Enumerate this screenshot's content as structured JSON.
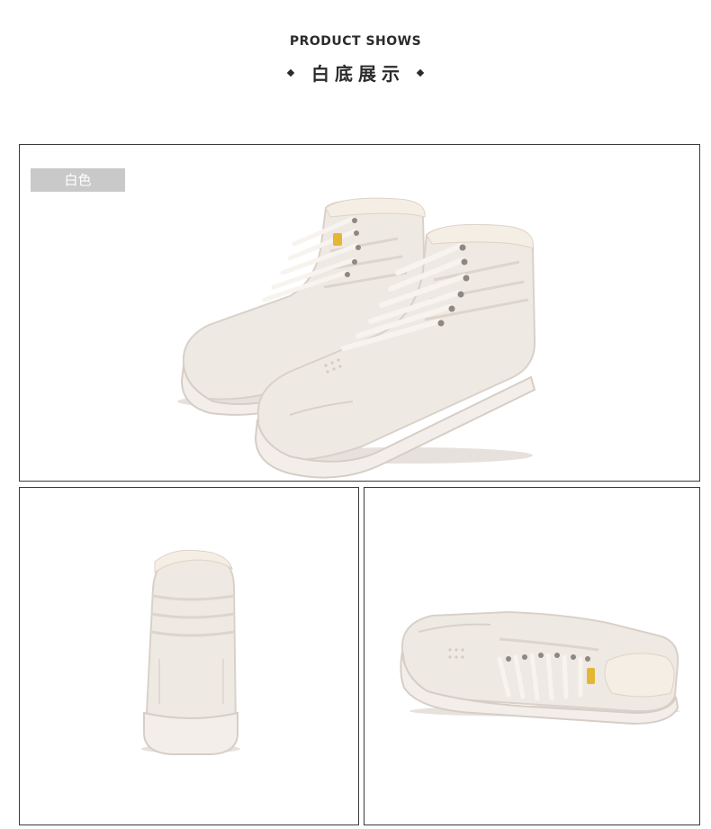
{
  "header": {
    "title_en": "PRODUCT SHOWS",
    "title_cn": "白底展示"
  },
  "panels": {
    "top": {
      "color_tag": "白色",
      "image": "white-high-top-sneakers-pair-front-view"
    },
    "bottom_left": {
      "image": "white-high-top-sneaker-back-view"
    },
    "bottom_right": {
      "image": "white-high-top-sneaker-side-view"
    }
  },
  "colors": {
    "shoe_body": "#efe9e3",
    "shoe_shadow": "#d9d1c9",
    "sole": "#f3eee9",
    "fur": "#f5eee4",
    "tag_bg": "#c9c9c9",
    "border": "#3a3a3a",
    "heading": "#2b2b2b"
  }
}
